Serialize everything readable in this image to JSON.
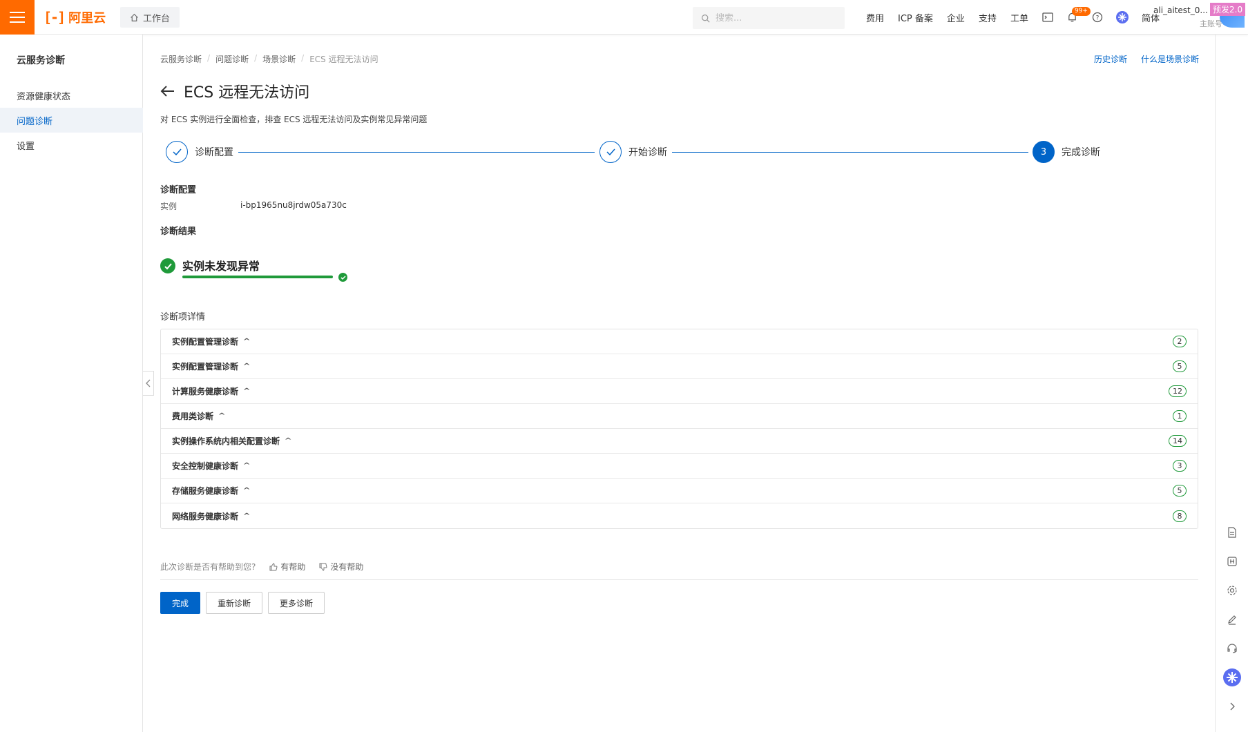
{
  "header": {
    "logo_text": "阿里云",
    "workbench_label": "工作台",
    "search_placeholder": "搜索...",
    "nav": [
      "费用",
      "ICP 备案",
      "企业",
      "支持",
      "工单"
    ],
    "notif_badge": "99+",
    "lang": "简体",
    "username": "ali_aitest_0...",
    "user_role": "主账号",
    "pre_tag": "预发2.0"
  },
  "sidebar": {
    "title": "云服务诊断",
    "items": [
      {
        "label": "资源健康状态"
      },
      {
        "label": "问题诊断"
      },
      {
        "label": "设置"
      }
    ]
  },
  "breadcrumb": [
    "云服务诊断",
    "问题诊断",
    "场景诊断",
    "ECS 远程无法访问"
  ],
  "top_links": {
    "history": "历史诊断",
    "what_is": "什么是场景诊断"
  },
  "page": {
    "title": "ECS 远程无法访问",
    "description": "对 ECS 实例进行全面检查，排查 ECS 远程无法访问及实例常见异常问题"
  },
  "steps": [
    {
      "label": "诊断配置",
      "status": "done"
    },
    {
      "label": "开始诊断",
      "status": "done"
    },
    {
      "label": "完成诊断",
      "status": "current",
      "number": "3"
    }
  ],
  "config": {
    "title": "诊断配置",
    "instance_label": "实例",
    "instance_value": "i-bp1965nu8jrdw05a730c"
  },
  "result": {
    "title": "诊断结果",
    "text": "实例未发现异常",
    "progress_percent": 100
  },
  "details": {
    "title": "诊断项详情",
    "items": [
      {
        "label": "实例配置管理诊断",
        "count": "2"
      },
      {
        "label": "实例配置管理诊断",
        "count": "5"
      },
      {
        "label": "计算服务健康诊断",
        "count": "12"
      },
      {
        "label": "费用类诊断",
        "count": "1"
      },
      {
        "label": "实例操作系统内相关配置诊断",
        "count": "14"
      },
      {
        "label": "安全控制健康诊断",
        "count": "3"
      },
      {
        "label": "存储服务健康诊断",
        "count": "5"
      },
      {
        "label": "网络服务健康诊断",
        "count": "8"
      }
    ]
  },
  "feedback": {
    "question": "此次诊断是否有帮助到您?",
    "helpful": "有帮助",
    "not_helpful": "没有帮助"
  },
  "actions": {
    "finish": "完成",
    "rediagnose": "重新诊断",
    "more": "更多诊断"
  },
  "colors": {
    "brand": "#ff6a00",
    "primary": "#0064c8",
    "success": "#1f9a3a"
  }
}
